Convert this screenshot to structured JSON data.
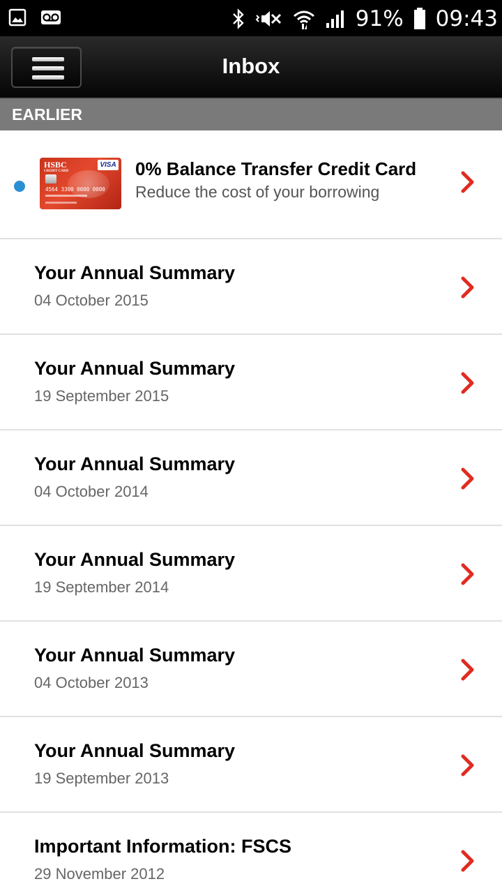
{
  "status_bar": {
    "battery": "91%",
    "time": "09:43",
    "icons": [
      "gallery-icon",
      "voicemail-icon",
      "bluetooth-icon",
      "vibrate-icon",
      "wifi-icon",
      "signal-icon",
      "battery-icon"
    ]
  },
  "header": {
    "title": "Inbox",
    "menu_icon": "hamburger-menu-icon"
  },
  "section": {
    "label": "EARLIER"
  },
  "promo": {
    "title": "0% Balance Transfer Credit Card",
    "subtitle": "Reduce the cost of your borrowing",
    "unread": true,
    "card_image": {
      "brand": "HSBC",
      "brand_sub": "CREDIT CARD",
      "network": "VISA",
      "number": "4564 3300 0000 0000"
    }
  },
  "messages": [
    {
      "title": "Your Annual Summary",
      "date": "04 October 2015"
    },
    {
      "title": "Your Annual Summary",
      "date": "19 September 2015"
    },
    {
      "title": "Your Annual Summary",
      "date": "04 October 2014"
    },
    {
      "title": "Your Annual Summary",
      "date": "19 September 2014"
    },
    {
      "title": "Your Annual Summary",
      "date": "04 October 2013"
    },
    {
      "title": "Your Annual Summary",
      "date": "19 September 2013"
    },
    {
      "title": "Important Information: FSCS",
      "date": "29 November 2012"
    }
  ],
  "colors": {
    "accent_chevron": "#e02b20",
    "unread_dot": "#2b8fd4",
    "section_bg": "#7a7a7a",
    "header_bg": "#0a0a0a"
  }
}
